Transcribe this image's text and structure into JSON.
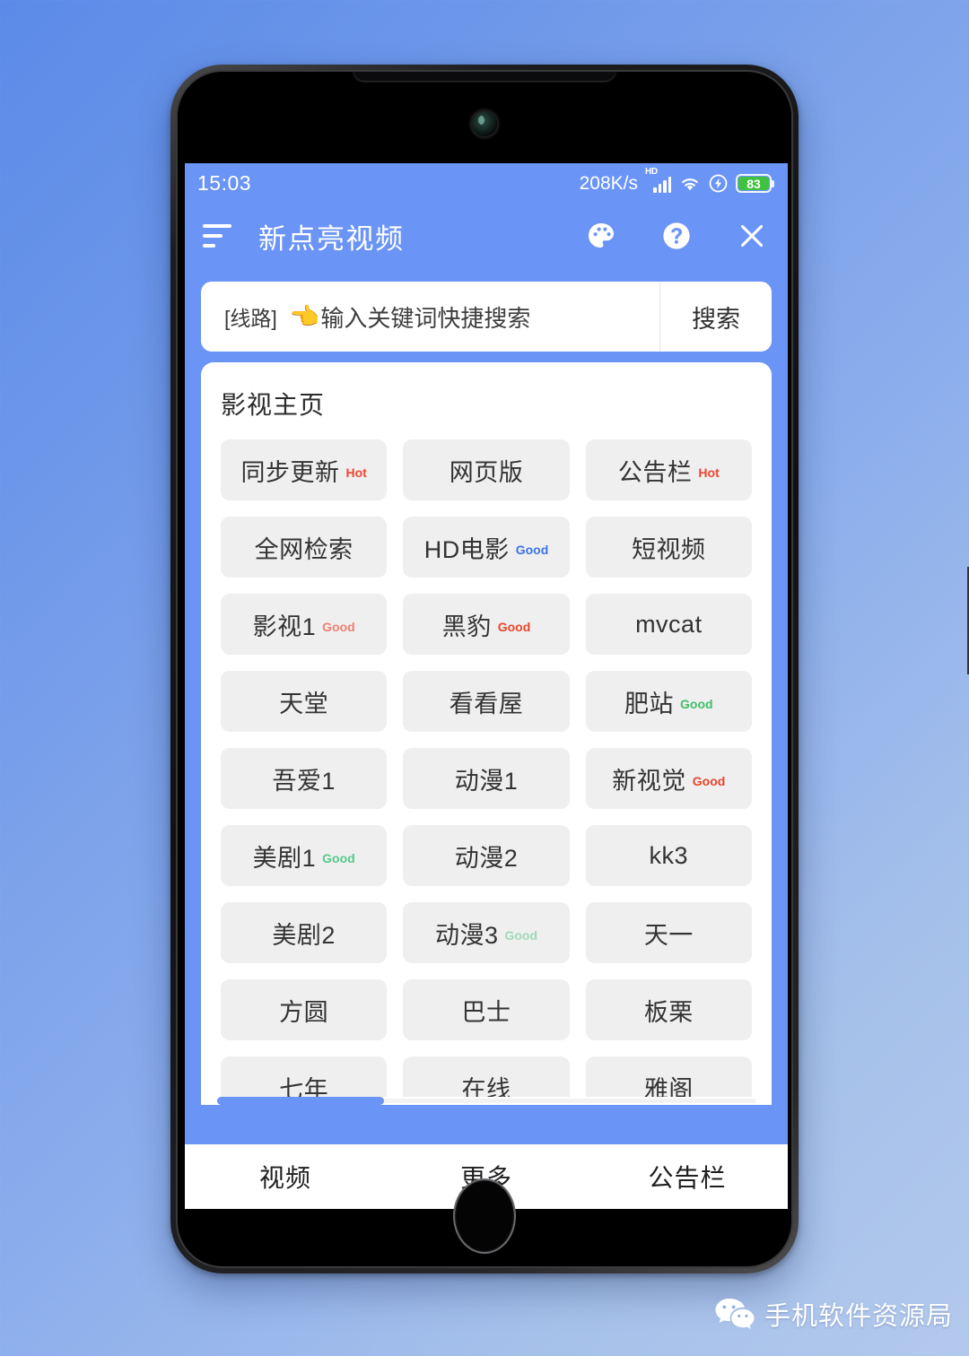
{
  "statusbar": {
    "time": "15:03",
    "network_speed": "208K/s",
    "hd_label": "HD",
    "signal_icon": "signal-bars-icon",
    "wifi_icon": "wifi-icon",
    "charging_icon": "charging-bolt-icon",
    "battery_level": "83"
  },
  "appbar": {
    "menu_icon": "menu-lines-icon",
    "title": "新点亮视频",
    "theme_icon": "palette-icon",
    "help_icon": "question-circle-icon",
    "close_icon": "close-x-icon"
  },
  "search": {
    "route_label": "[线路]",
    "pointer_emoji": "👈",
    "placeholder": "输入关键词快捷搜索",
    "button_label": "搜索"
  },
  "card": {
    "title": "影视主页",
    "tiles": [
      {
        "label": "同步更新",
        "badge": "Hot",
        "badge_color": "#f0462f"
      },
      {
        "label": "网页版",
        "badge": "",
        "badge_color": ""
      },
      {
        "label": "公告栏",
        "badge": "Hot",
        "badge_color": "#f0462f"
      },
      {
        "label": "全网检索",
        "badge": "",
        "badge_color": ""
      },
      {
        "label": "HD电影",
        "badge": "Good",
        "badge_color": "#3b73e8"
      },
      {
        "label": "短视频",
        "badge": "",
        "badge_color": ""
      },
      {
        "label": "影视1",
        "badge": "Good",
        "badge_color": "#ef8072"
      },
      {
        "label": "黑豹",
        "badge": "Good",
        "badge_color": "#e8442a"
      },
      {
        "label": "mvcat",
        "badge": "",
        "badge_color": ""
      },
      {
        "label": "天堂",
        "badge": "",
        "badge_color": ""
      },
      {
        "label": "看看屋",
        "badge": "",
        "badge_color": ""
      },
      {
        "label": "肥站",
        "badge": "Good",
        "badge_color": "#3fbf6a"
      },
      {
        "label": "吾爱1",
        "badge": "",
        "badge_color": ""
      },
      {
        "label": "动漫1",
        "badge": "",
        "badge_color": ""
      },
      {
        "label": "新视觉",
        "badge": "Good",
        "badge_color": "#e8442a"
      },
      {
        "label": "美剧1",
        "badge": "Good",
        "badge_color": "#55c98a"
      },
      {
        "label": "动漫2",
        "badge": "",
        "badge_color": ""
      },
      {
        "label": "kk3",
        "badge": "",
        "badge_color": ""
      },
      {
        "label": "美剧2",
        "badge": "",
        "badge_color": ""
      },
      {
        "label": "动漫3",
        "badge": "Good",
        "badge_color": "#9ed9b8"
      },
      {
        "label": "天一",
        "badge": "",
        "badge_color": ""
      },
      {
        "label": "方圆",
        "badge": "",
        "badge_color": ""
      },
      {
        "label": "巴士",
        "badge": "",
        "badge_color": ""
      },
      {
        "label": "板栗",
        "badge": "",
        "badge_color": ""
      },
      {
        "label": "七年",
        "badge": "",
        "badge_color": ""
      },
      {
        "label": "在线",
        "badge": "",
        "badge_color": ""
      },
      {
        "label": "雅阁",
        "badge": "",
        "badge_color": ""
      }
    ]
  },
  "bottomnav": {
    "items": [
      {
        "label": "视频"
      },
      {
        "label": "更多"
      },
      {
        "label": "公告栏"
      }
    ]
  },
  "watermark": {
    "icon": "wechat-icon",
    "text": "手机软件资源局"
  },
  "colors": {
    "app_blue": "#6b94f7",
    "tile_grey": "#efefef",
    "battery_green": "#3fc23f",
    "scrollbar_blue": "#6b94f7"
  }
}
